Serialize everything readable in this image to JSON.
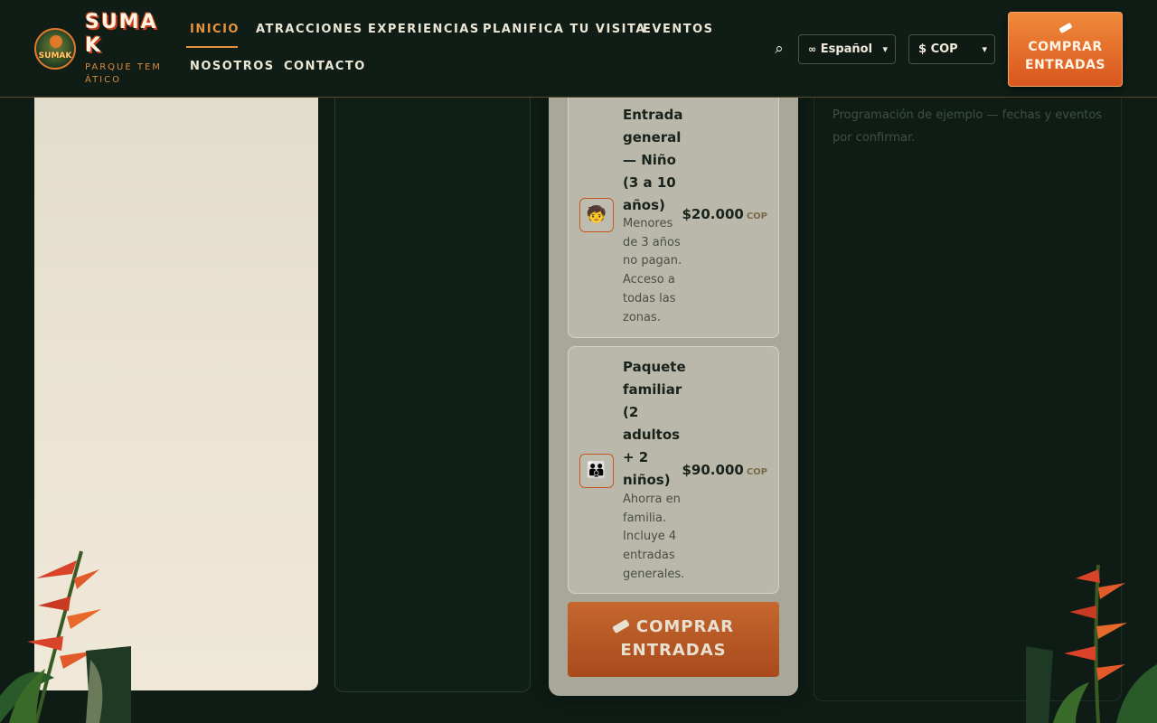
{
  "brand": {
    "name": "SUMAK",
    "subtitle": "PARQUE TEMÁTICO",
    "logo_text": "SUMAK"
  },
  "nav": {
    "items": [
      {
        "label": "INICIO",
        "active": true
      },
      {
        "label": "ATRACCIONES",
        "active": false
      },
      {
        "label": "EXPERIENCIAS",
        "active": false
      },
      {
        "label": "PLANIFICA TU VISITA",
        "active": false
      },
      {
        "label": "EVENTOS",
        "active": false
      },
      {
        "label": "NOSOTROS",
        "active": false
      },
      {
        "label": "CONTACTO",
        "active": false
      }
    ]
  },
  "header": {
    "language": {
      "selected": "Español",
      "icon": "globe-icon"
    },
    "currency": {
      "selected": "$ COP"
    },
    "buy_label": "COMPRAR ENTRADAS"
  },
  "tickets": {
    "items": [
      {
        "icon": "child-icon",
        "title": "Entrada general — Niño (3 a 10 años)",
        "description": "Menores de 3 años no pagan. Acceso a todas las zonas.",
        "price": "$20.000",
        "currency": "COP"
      },
      {
        "icon": "family-icon",
        "title": "Paquete familiar (2 adultos + 2 niños)",
        "description": "Ahorra en familia. Incluye 4 entradas generales.",
        "price": "$90.000",
        "currency": "COP"
      }
    ],
    "buy_label": "COMPRAR ENTRADAS"
  },
  "events": {
    "note": "Programación de ejemplo — fechas y eventos por confirmar."
  },
  "colors": {
    "accent": "#e8923a",
    "button": "#e06a2a",
    "background": "#0e1c15",
    "cream": "#ebe4d2"
  }
}
